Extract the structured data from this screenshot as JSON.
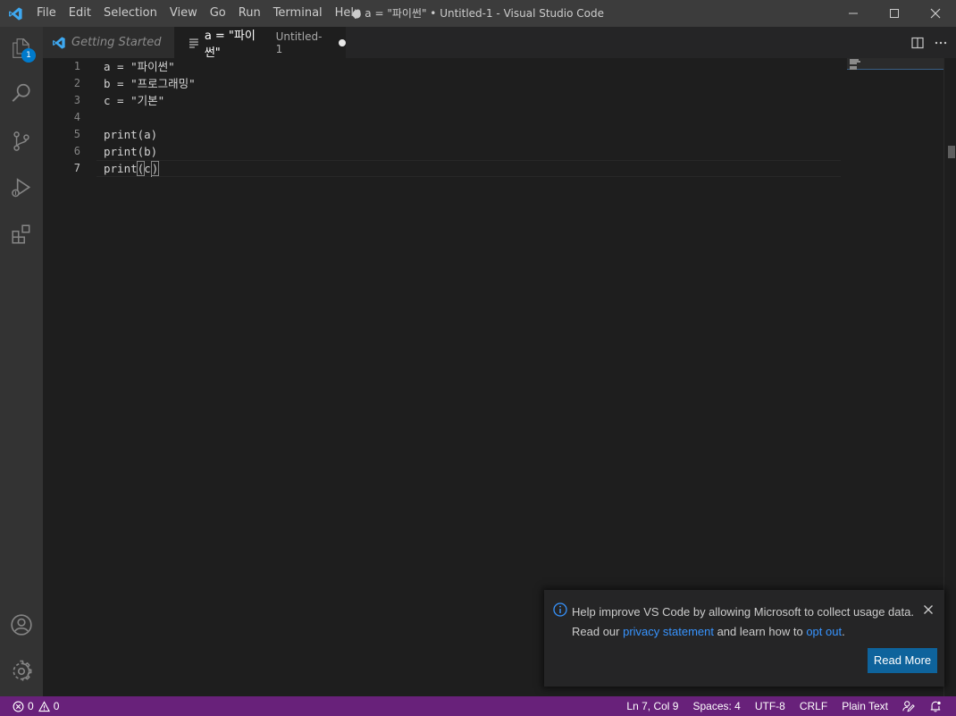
{
  "window": {
    "title": "● a = \"파이썬\" • Untitled-1 - Visual Studio Code",
    "menu": [
      "File",
      "Edit",
      "Selection",
      "View",
      "Go",
      "Run",
      "Terminal",
      "Help"
    ]
  },
  "activity_bar": {
    "items": [
      {
        "name": "explorer-icon",
        "badge": "1"
      },
      {
        "name": "search-icon"
      },
      {
        "name": "source-control-icon"
      },
      {
        "name": "run-debug-icon"
      },
      {
        "name": "extensions-icon"
      }
    ],
    "bottom": [
      {
        "name": "accounts-icon"
      },
      {
        "name": "settings-gear-icon"
      }
    ]
  },
  "tabs": [
    {
      "label": "Getting Started",
      "active": false
    },
    {
      "label": "a = \"파이썬\"",
      "description": "Untitled-1",
      "active": true,
      "dirty": true
    }
  ],
  "editor": {
    "lines": [
      {
        "num": "1",
        "text": "a = \"파이썬\""
      },
      {
        "num": "2",
        "text": "b = \"프로그래밍\""
      },
      {
        "num": "3",
        "text": "c = \"기본\""
      },
      {
        "num": "4",
        "text": ""
      },
      {
        "num": "5",
        "text": "print(a)"
      },
      {
        "num": "6",
        "text": "print(b)"
      },
      {
        "num": "7",
        "text": "print(c)"
      }
    ],
    "active_line": "7"
  },
  "notification": {
    "message_line1": "Help improve VS Code by allowing Microsoft to collect usage data.",
    "message_line2_prefix": "Read our ",
    "privacy_link": "privacy statement",
    "message_line2_middle": " and learn how to ",
    "optout_link": "opt out",
    "message_line2_suffix": ".",
    "button": "Read More"
  },
  "status_bar": {
    "errors": "0",
    "warnings": "0",
    "position": "Ln 7, Col 9",
    "spaces": "Spaces: 4",
    "encoding": "UTF-8",
    "eol": "CRLF",
    "language": "Plain Text",
    "color": "#68217a"
  }
}
